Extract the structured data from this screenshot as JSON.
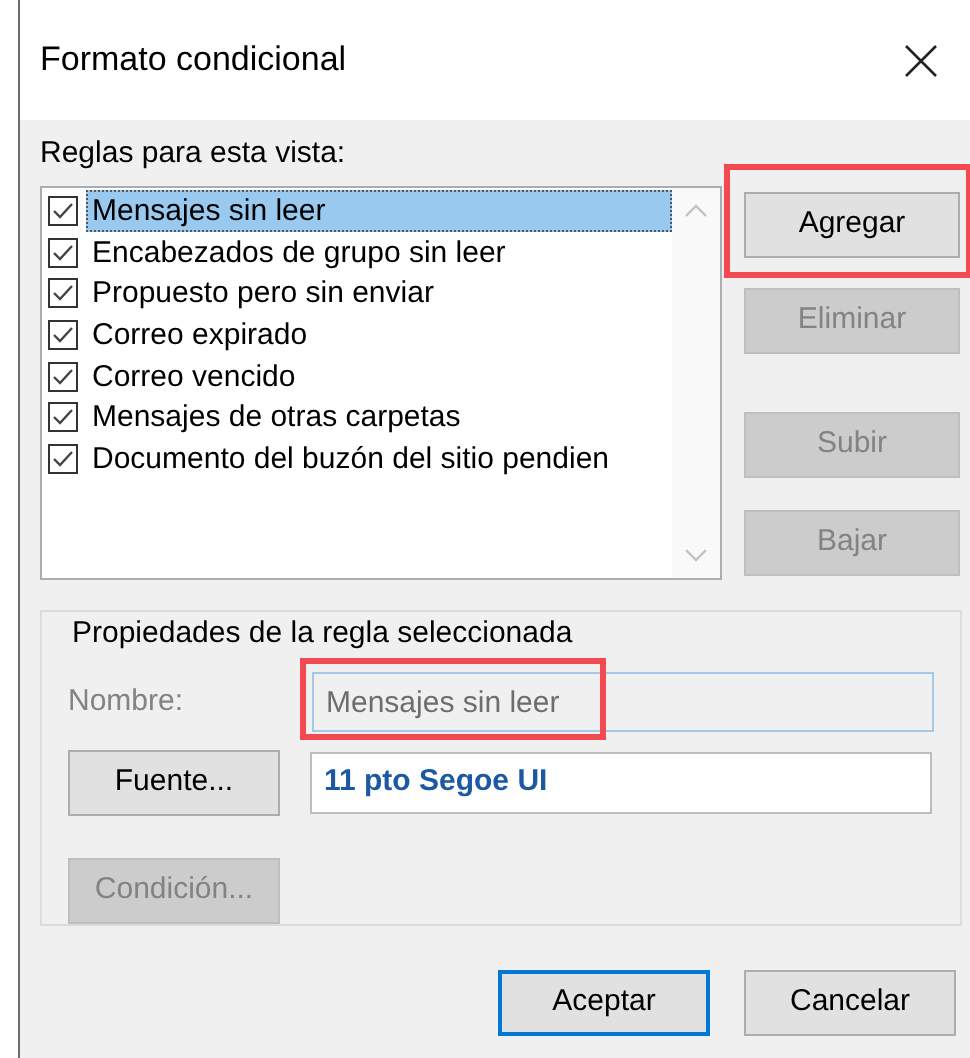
{
  "window": {
    "title": "Formato condicional"
  },
  "rules_label": "Reglas para esta vista:",
  "rules": [
    {
      "label": "Mensajes sin leer",
      "checked": true,
      "selected": true
    },
    {
      "label": "Encabezados de grupo sin leer",
      "checked": true,
      "selected": false
    },
    {
      "label": "Propuesto pero sin enviar",
      "checked": true,
      "selected": false
    },
    {
      "label": "Correo expirado",
      "checked": true,
      "selected": false
    },
    {
      "label": "Correo vencido",
      "checked": true,
      "selected": false
    },
    {
      "label": "Mensajes de otras carpetas",
      "checked": true,
      "selected": false
    },
    {
      "label": "Documento del buzón del sitio pendien",
      "checked": true,
      "selected": false
    }
  ],
  "side_buttons": [
    {
      "label": "Agregar",
      "disabled": false,
      "highlighted": true
    },
    {
      "label": "Eliminar",
      "disabled": true,
      "highlighted": false
    },
    {
      "label": "Subir",
      "disabled": true,
      "highlighted": false
    },
    {
      "label": "Bajar",
      "disabled": true,
      "highlighted": false
    }
  ],
  "properties": {
    "legend": "Propiedades de la regla seleccionada",
    "name_label": "Nombre:",
    "name_value": "Mensajes sin leer",
    "name_disabled": true,
    "name_highlighted": true,
    "font_button": {
      "label": "Fuente...",
      "disabled": false
    },
    "font_preview": "11 pto Segoe UI",
    "condition_button": {
      "label": "Condición...",
      "disabled": true
    }
  },
  "footer_buttons": [
    {
      "label": "Aceptar",
      "default": true
    },
    {
      "label": "Cancelar",
      "default": false
    }
  ]
}
